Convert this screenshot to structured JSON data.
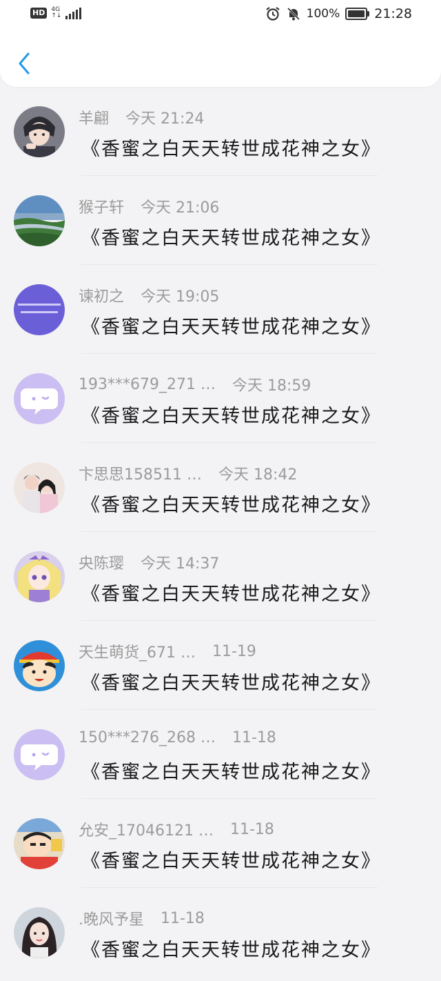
{
  "status_bar": {
    "hd": "HD",
    "network": "4G",
    "battery_pct": "100%",
    "battery_level": 1.0,
    "time": "21:28",
    "icons": [
      "signal-icon",
      "alarm-icon",
      "mute-icon",
      "battery-icon"
    ]
  },
  "nav": {
    "back_icon": "chevron-left-icon",
    "accent": "#1e9be8"
  },
  "comments": [
    {
      "user": "羊翩",
      "time": "今天 21:24",
      "message": "《香蜜之白天天转世成花神之女》",
      "avatar": "anime-boy"
    },
    {
      "user": "猴子轩",
      "time": "今天 21:06",
      "message": "《香蜜之白天天转世成花神之女》",
      "avatar": "landscape"
    },
    {
      "user": "谏初之",
      "time": "今天 19:05",
      "message": "《香蜜之白天天转世成花神之女》",
      "avatar": "purple-text"
    },
    {
      "user": "193***679_271 …",
      "time": "今天 18:59",
      "message": "《香蜜之白天天转世成花神之女》",
      "avatar": "default-bubble"
    },
    {
      "user": "卞思思158511 …",
      "time": "今天 18:42",
      "message": "《香蜜之白天天转世成花神之女》",
      "avatar": "couple"
    },
    {
      "user": "央陈璎",
      "time": "今天 14:37",
      "message": "《香蜜之白天天转世成花神之女》",
      "avatar": "anime-girl"
    },
    {
      "user": "天生萌货_671 …",
      "time": "11-19",
      "message": "《香蜜之白天天转世成花神之女》",
      "avatar": "cartoon-kid"
    },
    {
      "user": "150***276_268 …",
      "time": "11-18",
      "message": "《香蜜之白天天转世成花神之女》",
      "avatar": "default-bubble"
    },
    {
      "user": "允安_17046121 …",
      "time": "11-18",
      "message": "《香蜜之白天天转世成花神之女》",
      "avatar": "crayon-shin"
    },
    {
      "user": ".晚风予星",
      "time": "11-18",
      "message": "《香蜜之白天天转世成花神之女》",
      "avatar": "portrait-girl"
    }
  ]
}
